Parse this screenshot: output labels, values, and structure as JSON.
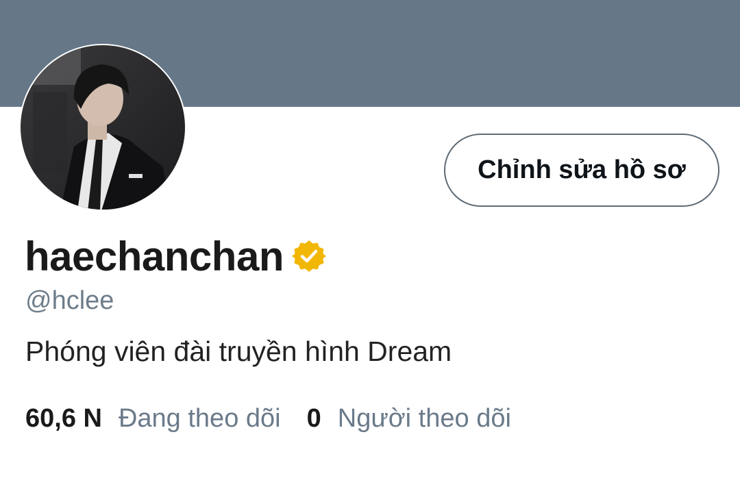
{
  "profile": {
    "display_name": "haechanchan",
    "handle": "@hclee",
    "bio": "Phóng viên đài truyền hình Dream",
    "verified_badge_icon": "verified-badge-icon",
    "verified_badge_color": "#F2B705"
  },
  "header": {
    "banner_color": "#667788"
  },
  "actions": {
    "edit_profile_label": "Chỉnh sửa hồ sơ"
  },
  "stats": {
    "following_count": "60,6 N",
    "following_label": "Đang theo dõi",
    "followers_count": "0",
    "followers_label": "Người theo dõi"
  }
}
